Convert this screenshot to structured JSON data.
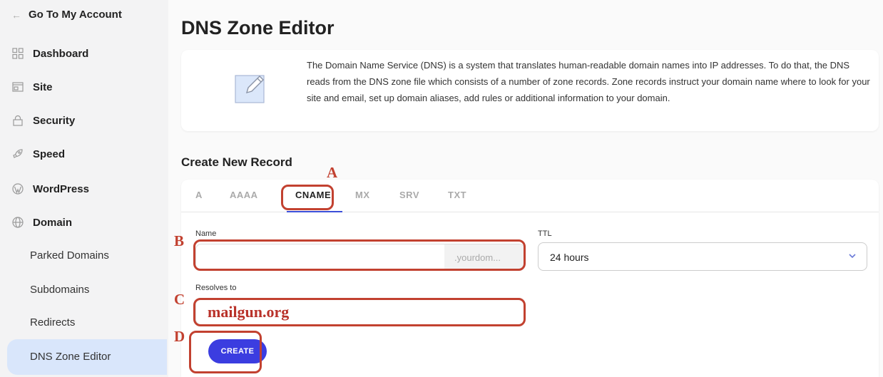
{
  "sidebar": {
    "back_label": "Go To My Account",
    "items": [
      {
        "label": "Dashboard",
        "icon": "grid-icon"
      },
      {
        "label": "Site",
        "icon": "window-icon"
      },
      {
        "label": "Security",
        "icon": "lock-icon"
      },
      {
        "label": "Speed",
        "icon": "rocket-icon"
      },
      {
        "label": "WordPress",
        "icon": "wordpress-icon"
      },
      {
        "label": "Domain",
        "icon": "globe-icon"
      }
    ],
    "sub_items": [
      "Parked Domains",
      "Subdomains",
      "Redirects",
      "DNS Zone Editor"
    ],
    "active_sub_item": "DNS Zone Editor"
  },
  "main": {
    "title": "DNS Zone Editor",
    "info_text": "The Domain Name Service (DNS) is a system that translates human-readable domain names into IP addresses. To do that, the DNS reads from the DNS zone file which consists of a number of zone records. Zone records instruct your domain name where to look for your site and email, set up domain aliases, add rules or additional information to your domain.",
    "section_title": "Create New Record",
    "tabs": [
      "A",
      "AAAA",
      "CNAME",
      "MX",
      "SRV",
      "TXT"
    ],
    "active_tab": "CNAME",
    "form": {
      "name_label": "Name",
      "name_value": "",
      "name_suffix": ".yourdom...",
      "ttl_label": "TTL",
      "ttl_value": "24 hours",
      "resolves_label": "Resolves to",
      "resolves_value": "mailgun.org",
      "create_label": "CREATE"
    }
  },
  "annotations": {
    "A": "A",
    "B": "B",
    "C": "C",
    "D": "D",
    "color": "#c24130"
  },
  "colors": {
    "accent": "#3b3de0",
    "active_sidebar_bg": "#d9e6fb"
  }
}
